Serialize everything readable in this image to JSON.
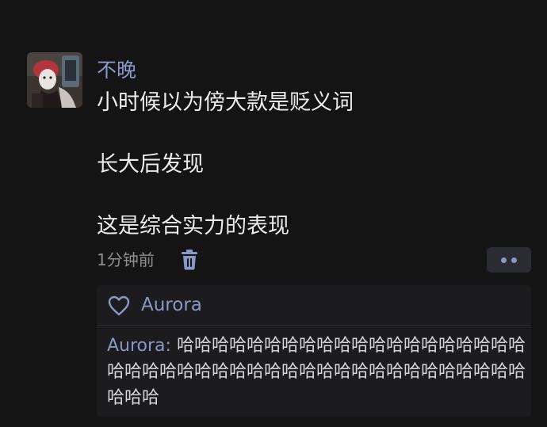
{
  "post": {
    "username": "不晚",
    "lines": [
      "小时候以为傍大款是贬义词",
      "",
      "长大后发现",
      "",
      "这是综合实力的表现"
    ],
    "time": "1分钟前",
    "delete_icon": "trash-icon",
    "more_icon": "more-dots-icon"
  },
  "likes": {
    "icon": "heart-outline-icon",
    "name": "Aurora"
  },
  "reply": {
    "author": "Aurora",
    "separator": ": ",
    "text": "哈哈哈哈哈哈哈哈哈哈哈哈哈哈哈哈哈哈哈哈哈哈哈哈哈哈哈哈哈哈哈哈哈哈哈哈哈哈哈哈哈哈哈哈哈哈哈"
  },
  "colors": {
    "background": "#141414",
    "accent": "#8c97c9",
    "text": "#ececec",
    "muted": "#8f8f8f",
    "panel": "#1c1c1e"
  }
}
